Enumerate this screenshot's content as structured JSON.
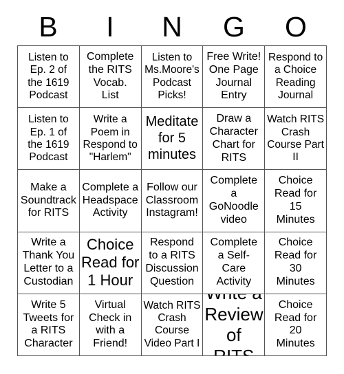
{
  "header": {
    "letters": [
      "B",
      "I",
      "N",
      "G",
      "O"
    ]
  },
  "grid": {
    "columns": 5,
    "rows": 5,
    "border_color": "#555555",
    "background_color": "#ffffff",
    "text_color": "#000000",
    "cells": [
      {
        "text": "Listen to\nEp. 2 of\nthe 1619\nPodcast",
        "size": "sm"
      },
      {
        "text": "Complete\nthe RITS\nVocab.\nList",
        "size": "md"
      },
      {
        "text": "Listen to\nMs.Moore's\nPodcast\nPicks!",
        "size": "sm"
      },
      {
        "text": "Free Write!\nOne Page\nJournal\nEntry",
        "size": "md"
      },
      {
        "text": "Respond to\na Choice\nReading\nJournal",
        "size": "sm"
      },
      {
        "text": "Listen to\nEp. 1 of\nthe 1619\nPodcast",
        "size": "sm"
      },
      {
        "text": "Write a\nPoem in\nRespond to\n\"Harlem\"",
        "size": "sm"
      },
      {
        "text": "Meditate\nfor 5\nminutes",
        "size": "lg"
      },
      {
        "text": "Draw a\nCharacter\nChart for\nRITS",
        "size": "md"
      },
      {
        "text": "Watch RITS\nCrash\nCourse Part\nII",
        "size": "sm"
      },
      {
        "text": "Make a\nSoundtrack\nfor RITS",
        "size": "md"
      },
      {
        "text": "Complete a\nHeadspace\nActivity",
        "size": "md"
      },
      {
        "text": "Follow our\nClassroom\nInstagram!",
        "size": "md"
      },
      {
        "text": "Complete\na\nGoNoodle\nvideo",
        "size": "md"
      },
      {
        "text": "Choice\nRead for\n15\nMinutes",
        "size": "md"
      },
      {
        "text": "Write a\nThank You\nLetter to a\nCustodian",
        "size": "md"
      },
      {
        "text": "Choice\nRead for\n1 Hour",
        "size": "xl"
      },
      {
        "text": "Respond\nto a RITS\nDiscussion\nQuestion",
        "size": "md"
      },
      {
        "text": "Complete\na Self-\nCare\nActivity",
        "size": "md"
      },
      {
        "text": "Choice\nRead for\n30\nMinutes",
        "size": "md"
      },
      {
        "text": "Write 5\nTweets for\na RITS\nCharacter",
        "size": "md"
      },
      {
        "text": "Virtual\nCheck in\nwith a\nFriend!",
        "size": "md"
      },
      {
        "text": "Watch RITS\nCrash\nCourse\nVideo Part I",
        "size": "sm"
      },
      {
        "text": "Write a\nReview\nof RITS",
        "size": "xxl"
      },
      {
        "text": "Choice\nRead for\n20\nMinutes",
        "size": "md"
      }
    ]
  }
}
